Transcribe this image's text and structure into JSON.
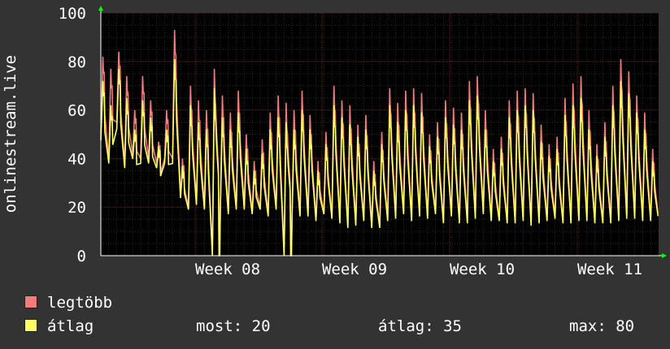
{
  "chart_data": {
    "type": "line",
    "ylabel": "onlinestream.live",
    "ylim": [
      0,
      100
    ],
    "y_ticks": [
      "0",
      "20",
      "40",
      "60",
      "80",
      "100"
    ],
    "x_ticks": [
      "Week 08",
      "Week 09",
      "Week 10",
      "Week 11"
    ],
    "grid": true,
    "colors": {
      "max": "#f07c7c",
      "avg": "#ffff66",
      "background": "#000000",
      "grid": "#5a1f1f",
      "axis": "#00ff00"
    },
    "series": [
      {
        "name": "legtöbb",
        "daily_peaks": [
          80,
          75,
          82,
          72,
          58,
          72,
          62,
          45,
          58,
          91,
          38,
          68,
          62,
          58,
          75,
          64,
          57,
          66,
          48,
          37,
          46,
          57,
          64,
          61,
          58,
          66,
          56,
          37,
          49,
          68,
          62,
          60,
          52,
          56,
          37,
          49,
          67,
          61,
          66,
          67,
          65,
          48,
          53,
          62,
          59,
          57,
          70,
          72,
          58,
          42,
          47,
          62,
          66,
          67,
          65,
          52,
          44,
          47,
          63,
          69,
          72,
          58,
          44,
          53,
          68,
          79,
          74,
          64,
          57,
          42
        ],
        "daily_troughs": [
          50,
          40,
          55,
          38,
          42,
          40,
          40,
          38,
          40,
          40,
          25,
          20,
          22,
          20,
          0,
          20,
          18,
          20,
          20,
          18,
          20,
          17,
          20,
          0,
          17,
          17,
          17,
          15,
          18,
          16,
          14,
          12,
          13,
          15,
          12,
          12,
          15,
          16,
          18,
          15,
          17,
          16,
          18,
          14,
          17,
          14,
          14,
          16,
          18,
          15,
          15,
          14,
          14,
          15,
          13,
          14,
          15,
          16,
          14,
          14,
          15,
          15,
          14,
          14,
          14,
          15,
          16,
          16,
          15,
          15
        ]
      },
      {
        "name": "átlag",
        "daily_peaks": [
          70,
          60,
          75,
          63,
          50,
          62,
          55,
          43,
          50,
          79,
          35,
          60,
          53,
          50,
          67,
          55,
          50,
          57,
          42,
          33,
          40,
          50,
          55,
          53,
          50,
          58,
          50,
          33,
          44,
          60,
          55,
          52,
          47,
          50,
          33,
          44,
          60,
          53,
          58,
          60,
          57,
          43,
          47,
          55,
          52,
          50,
          62,
          64,
          50,
          37,
          42,
          55,
          58,
          60,
          58,
          45,
          39,
          42,
          56,
          60,
          63,
          50,
          39,
          47,
          60,
          70,
          65,
          57,
          50,
          37
        ]
      }
    ]
  },
  "legend": [
    {
      "label": "legtöbb",
      "color": "#f07c7c"
    },
    {
      "label": "átlag",
      "color": "#ffff66"
    }
  ],
  "stats": {
    "most": "most: 20",
    "atlag": "átlag: 35",
    "max": "max: 80"
  }
}
